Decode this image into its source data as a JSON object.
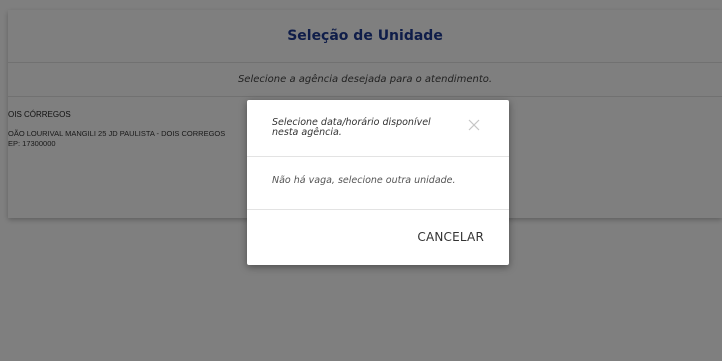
{
  "card": {
    "title": "Seleção de Unidade",
    "subtitle": "Selecione a agência desejada para o atendimento."
  },
  "unit": {
    "name": "OIS CÓRREGOS",
    "address": "OÃO LOURIVAL MANGILI 25 JD PAULISTA - DOIS CORREGOS",
    "cep": "EP: 17300000"
  },
  "modal": {
    "title": "Selecione data/horário disponível nesta agência.",
    "message": "Não há vaga, selecione outra unidade.",
    "cancel_label": "CANCELAR"
  },
  "icons": {
    "close": "close-icon"
  }
}
